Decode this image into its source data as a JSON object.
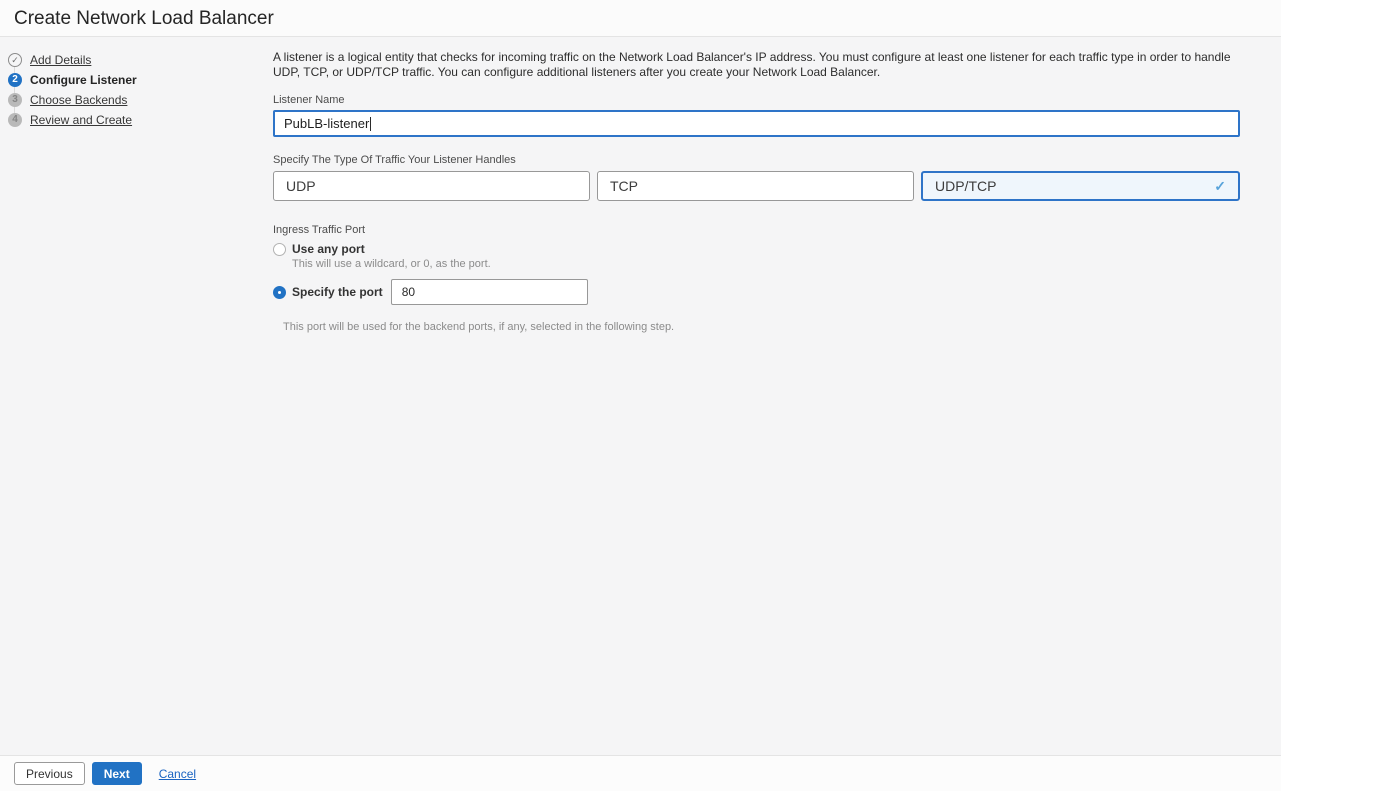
{
  "accent_color": "#2172c4",
  "selected_card_bg": "#eff6fc",
  "icons": {
    "check": "✓"
  },
  "header": {
    "title": "Create Network Load Balancer"
  },
  "steps": [
    {
      "label": "Add Details",
      "status": "complete",
      "number": ""
    },
    {
      "label": "Configure Listener",
      "status": "active",
      "number": "2"
    },
    {
      "label": "Choose Backends",
      "status": "upcoming",
      "number": "3"
    },
    {
      "label": "Review and Create",
      "status": "upcoming",
      "number": "4"
    }
  ],
  "main": {
    "description": "A listener is a logical entity that checks for incoming traffic on the Network Load Balancer's IP address. You must configure at least one listener for each traffic type in order to handle UDP, TCP, or UDP/TCP traffic. You can configure additional listeners after you create your Network Load Balancer.",
    "listener_name": {
      "label": "Listener Name",
      "value": "PubLB-listener"
    },
    "traffic_type": {
      "label": "Specify The Type Of Traffic Your Listener Handles",
      "options": [
        {
          "label": "UDP",
          "selected": false
        },
        {
          "label": "TCP",
          "selected": false
        },
        {
          "label": "UDP/TCP",
          "selected": true
        }
      ]
    },
    "ingress_port": {
      "label": "Ingress Traffic Port",
      "options": [
        {
          "label": "Use any port",
          "selected": false,
          "help": "This will use a wildcard, or 0, as the port."
        },
        {
          "label": "Specify the port",
          "selected": true,
          "value": "80"
        }
      ],
      "footnote": "This port will be used for the backend ports, if any, selected in the following step."
    }
  },
  "footer": {
    "previous_label": "Previous",
    "next_label": "Next",
    "cancel_label": "Cancel"
  }
}
